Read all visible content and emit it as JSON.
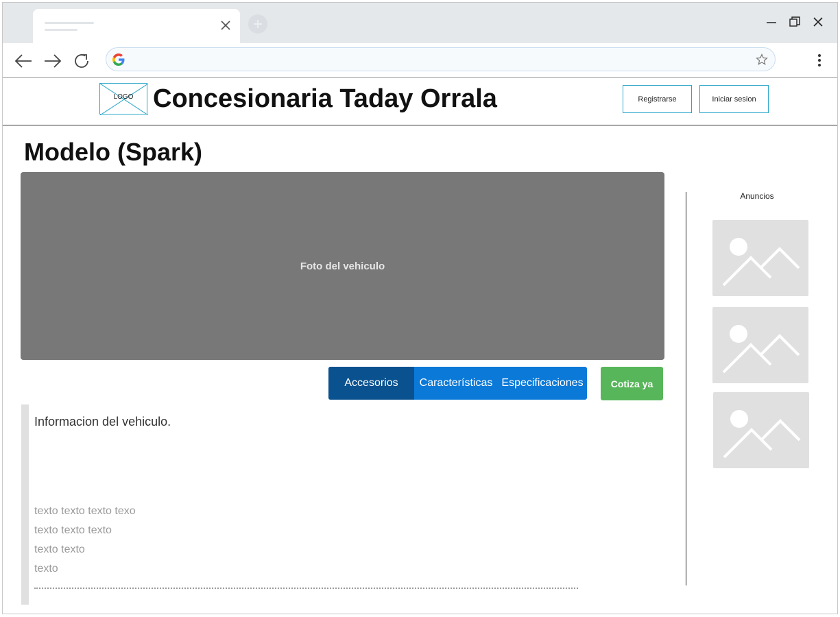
{
  "header": {
    "logo_text": "LOGO",
    "site_title": "Concesionaria Taday Orrala",
    "register_label": "Registrarse",
    "login_label": "Iniciar sesion"
  },
  "main": {
    "model_title": "Modelo (Spark)",
    "photo_label": "Foto del vehiculo",
    "tabs": [
      {
        "label": "Accesorios",
        "active": true
      },
      {
        "label": "Características",
        "active": false
      },
      {
        "label": "Especificaciones",
        "active": false
      }
    ],
    "quote_label": "Cotiza ya",
    "info_title": "Informacion del vehiculo.",
    "info_lines": [
      "texto texto texto texo",
      "texto texto texto",
      "texto texto",
      "texto"
    ]
  },
  "sidebar": {
    "ads_label": "Anuncios",
    "ads": [
      "image-placeholder-icon",
      "image-placeholder-icon",
      "image-placeholder-icon"
    ]
  },
  "colors": {
    "accent_border": "#2aa6c8",
    "tab_active": "#0a518f",
    "tab_bg": "#0a79d8",
    "quote_button": "#58b65a",
    "photo_bg": "#787878"
  }
}
